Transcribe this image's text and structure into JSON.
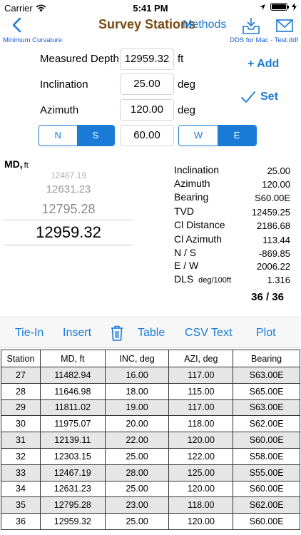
{
  "status": {
    "carrier": "Carrier",
    "time": "5:41 PM"
  },
  "nav": {
    "title": "Survey Stations",
    "methods": "Methods",
    "method_name": "Minimum Curvature",
    "file_name": "DDS for Mac - Test.ddf"
  },
  "inputs": {
    "md_label": "Measured Depth",
    "md_value": "12959.32",
    "md_unit": "ft",
    "inc_label": "Inclination",
    "inc_value": "25.00",
    "inc_unit": "deg",
    "azi_label": "Azimuth",
    "azi_value": "120.00",
    "azi_unit": "deg",
    "ns": [
      "N",
      "S"
    ],
    "bearing_value": "60.00",
    "ew": [
      "W",
      "E"
    ],
    "add": "+ Add",
    "set": "Set"
  },
  "picker": {
    "label": "MD,",
    "unit": "ft",
    "values": [
      "12467.19",
      "12631.23",
      "12795.28",
      "12959.32"
    ]
  },
  "results": [
    {
      "label": "Inclination",
      "value": "25.00"
    },
    {
      "label": "Azimuth",
      "value": "120.00"
    },
    {
      "label": "Bearing",
      "value": "S60.00E"
    },
    {
      "label": "TVD",
      "value": "12459.25"
    },
    {
      "label": "Cl Distance",
      "value": "2186.68"
    },
    {
      "label": "Cl Azimuth",
      "value": "113.44"
    },
    {
      "label": "N / S",
      "value": "-869.85"
    },
    {
      "label": "E / W",
      "value": "2006.22"
    },
    {
      "label": "DLS",
      "unit": "deg/100ft",
      "value": "1.316"
    }
  ],
  "count": "36 / 36",
  "toolbar": {
    "tiein": "Tie-In",
    "insert": "Insert",
    "table": "Table",
    "csv": "CSV Text",
    "plot": "Plot"
  },
  "table": {
    "headers": [
      "Station",
      "MD, ft",
      "INC, deg",
      "AZI, deg",
      "Bearing"
    ],
    "rows": [
      [
        "27",
        "11482.94",
        "16.00",
        "117.00",
        "S63.00E"
      ],
      [
        "28",
        "11646.98",
        "18.00",
        "115.00",
        "S65.00E"
      ],
      [
        "29",
        "11811.02",
        "19.00",
        "117.00",
        "S63.00E"
      ],
      [
        "30",
        "11975.07",
        "20.00",
        "118.00",
        "S62.00E"
      ],
      [
        "31",
        "12139.11",
        "22.00",
        "120.00",
        "S60.00E"
      ],
      [
        "32",
        "12303.15",
        "25.00",
        "122.00",
        "S58.00E"
      ],
      [
        "33",
        "12467.19",
        "28.00",
        "125.00",
        "S55.00E"
      ],
      [
        "34",
        "12631.23",
        "25.00",
        "120.00",
        "S60.00E"
      ],
      [
        "35",
        "12795.28",
        "23.00",
        "118.00",
        "S62.00E"
      ],
      [
        "36",
        "12959.32",
        "25.00",
        "120.00",
        "S60.00E"
      ]
    ]
  }
}
